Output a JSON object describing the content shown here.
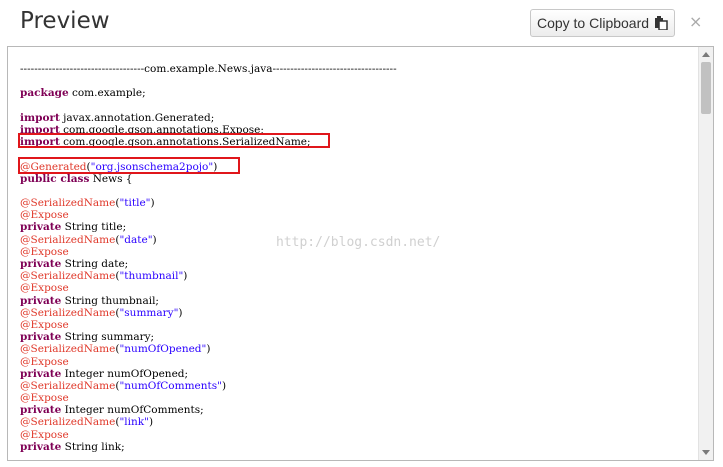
{
  "header": {
    "title": "Preview",
    "copy_button_label": "Copy to Clipboard",
    "close_label": "×"
  },
  "code": {
    "lines": [
      [
        [
          "",
          "-----------------------------------com.example.News.java-----------------------------------"
        ]
      ],
      [
        [
          "",
          ""
        ]
      ],
      [
        [
          "kw",
          "package"
        ],
        [
          "",
          " com.example;"
        ]
      ],
      [
        [
          "",
          ""
        ]
      ],
      [
        [
          "kw",
          "import"
        ],
        [
          "",
          " javax.annotation.Generated;"
        ]
      ],
      [
        [
          "kw",
          "import"
        ],
        [
          "",
          " com.google.gson.annotations.Expose;"
        ]
      ],
      [
        [
          "kw",
          "import"
        ],
        [
          "",
          " com.google.gson.annotations.SerializedName;"
        ]
      ],
      [
        [
          "",
          ""
        ]
      ],
      [
        [
          "ann",
          "@Generated"
        ],
        [
          "",
          "("
        ],
        [
          "str",
          "\"org.jsonschema2pojo\""
        ],
        [
          "",
          ")"
        ]
      ],
      [
        [
          "kw",
          "public class"
        ],
        [
          "",
          " News {"
        ]
      ],
      [
        [
          "",
          ""
        ]
      ],
      [
        [
          "ann",
          "@SerializedName"
        ],
        [
          "",
          "("
        ],
        [
          "str",
          "\"title\""
        ],
        [
          "",
          ")"
        ]
      ],
      [
        [
          "ann",
          "@Expose"
        ]
      ],
      [
        [
          "kw",
          "private"
        ],
        [
          "",
          " String title;"
        ]
      ],
      [
        [
          "ann",
          "@SerializedName"
        ],
        [
          "",
          "("
        ],
        [
          "str",
          "\"date\""
        ],
        [
          "",
          ")"
        ]
      ],
      [
        [
          "ann",
          "@Expose"
        ]
      ],
      [
        [
          "kw",
          "private"
        ],
        [
          "",
          " String date;"
        ]
      ],
      [
        [
          "ann",
          "@SerializedName"
        ],
        [
          "",
          "("
        ],
        [
          "str",
          "\"thumbnail\""
        ],
        [
          "",
          ")"
        ]
      ],
      [
        [
          "ann",
          "@Expose"
        ]
      ],
      [
        [
          "kw",
          "private"
        ],
        [
          "",
          " String thumbnail;"
        ]
      ],
      [
        [
          "ann",
          "@SerializedName"
        ],
        [
          "",
          "("
        ],
        [
          "str",
          "\"summary\""
        ],
        [
          "",
          ")"
        ]
      ],
      [
        [
          "ann",
          "@Expose"
        ]
      ],
      [
        [
          "kw",
          "private"
        ],
        [
          "",
          " String summary;"
        ]
      ],
      [
        [
          "ann",
          "@SerializedName"
        ],
        [
          "",
          "("
        ],
        [
          "str",
          "\"numOfOpened\""
        ],
        [
          "",
          ")"
        ]
      ],
      [
        [
          "ann",
          "@Expose"
        ]
      ],
      [
        [
          "kw",
          "private"
        ],
        [
          "",
          " Integer numOfOpened;"
        ]
      ],
      [
        [
          "ann",
          "@SerializedName"
        ],
        [
          "",
          "("
        ],
        [
          "str",
          "\"numOfComments\""
        ],
        [
          "",
          ")"
        ]
      ],
      [
        [
          "ann",
          "@Expose"
        ]
      ],
      [
        [
          "kw",
          "private"
        ],
        [
          "",
          " Integer numOfComments;"
        ]
      ],
      [
        [
          "ann",
          "@SerializedName"
        ],
        [
          "",
          "("
        ],
        [
          "str",
          "\"link\""
        ],
        [
          "",
          ")"
        ]
      ],
      [
        [
          "ann",
          "@Expose"
        ]
      ],
      [
        [
          "kw",
          "private"
        ],
        [
          "",
          " String link;"
        ]
      ]
    ]
  },
  "watermark": "http://blog.csdn.net/",
  "colors": {
    "keyword": "#7f0055",
    "annotation": "#e0392b",
    "string": "#2a00ff",
    "highlight_box": "#e0161b"
  },
  "icons": {
    "copy_button_icon": "clipboard-icon",
    "close_icon": "close-icon",
    "scroll_up": "arrow-up-icon",
    "scroll_down": "arrow-down-icon"
  }
}
